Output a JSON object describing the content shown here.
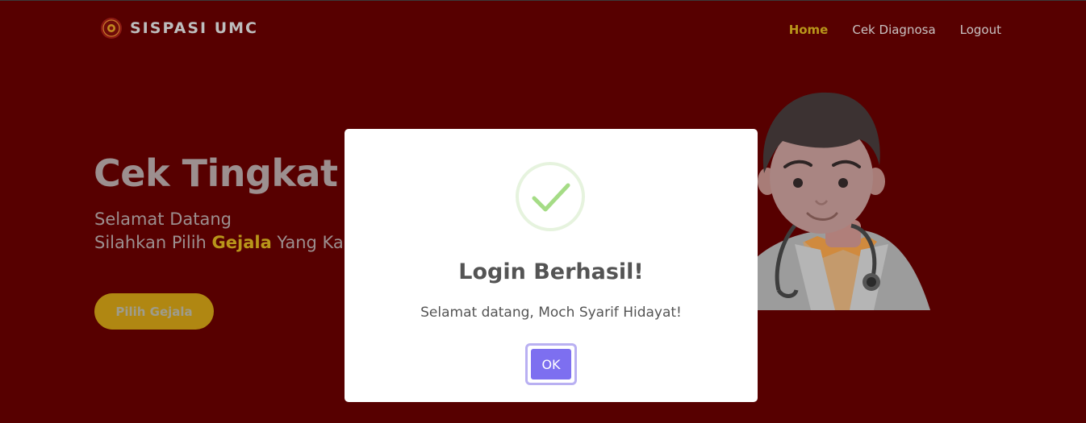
{
  "navbar": {
    "brand": "SISPASI UMC",
    "links": [
      "Home",
      "Cek Diagnosa",
      "Logout"
    ],
    "active_link": "Home"
  },
  "hero": {
    "title": "Cek Tingkat D",
    "line1": "Selamat Datang",
    "line2_before": "Silahkan Pilih ",
    "line2_highlight": "Gejala",
    "line2_after": " Yang Ka",
    "button": "Pilih Gejala"
  },
  "modal": {
    "title": "Login Berhasil!",
    "text": "Selamat datang, Moch Syarif Hidayat!",
    "ok": "OK"
  },
  "colors": {
    "background": "#570000",
    "accent": "#b9961a",
    "button_primary": "#7d6ff0",
    "success": "#a5dc86"
  }
}
